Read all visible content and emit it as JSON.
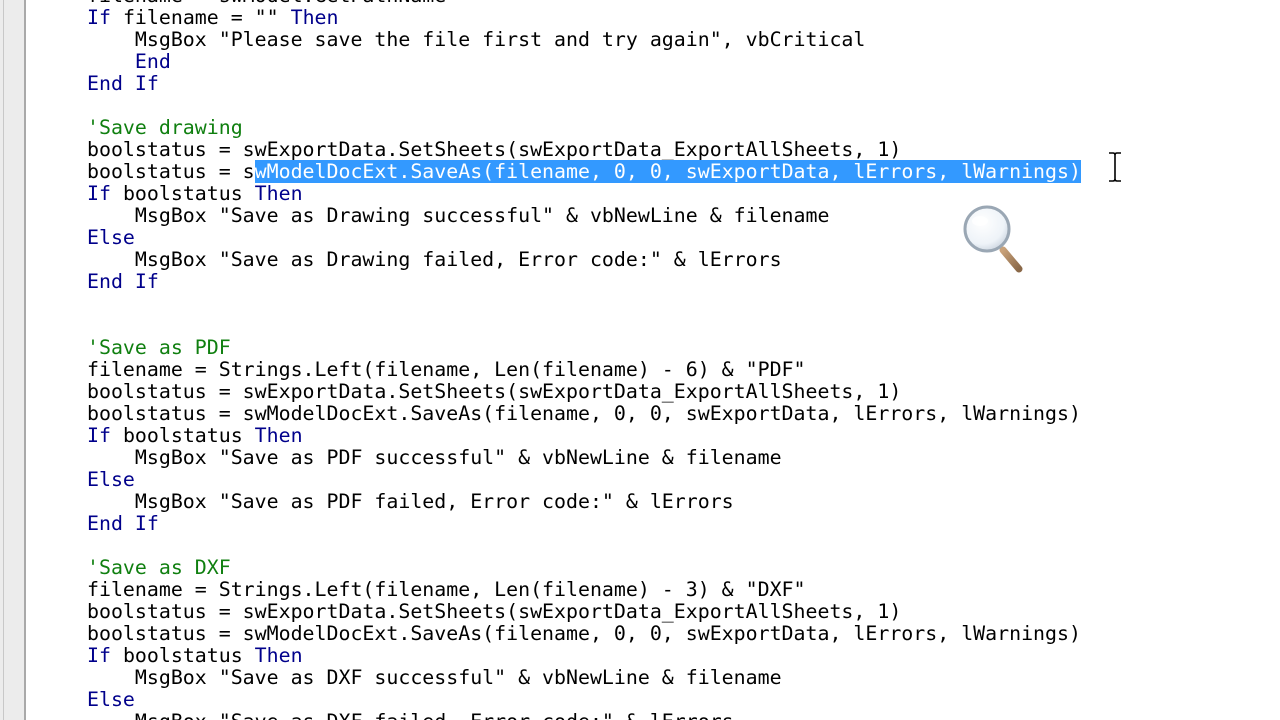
{
  "editor": {
    "lines": [
      [
        {
          "t": "filename = swModel.GetPathName",
          "c": "text"
        }
      ],
      [
        {
          "t": "If ",
          "c": "keyword"
        },
        {
          "t": "filename = \"\" ",
          "c": "text"
        },
        {
          "t": "Then",
          "c": "keyword"
        }
      ],
      [
        {
          "t": "    MsgBox \"Please save the file first and try again\", vbCritical",
          "c": "text"
        }
      ],
      [
        {
          "t": "    End",
          "c": "keyword"
        }
      ],
      [
        {
          "t": "End If",
          "c": "keyword"
        }
      ],
      [
        {
          "t": "",
          "c": "text"
        }
      ],
      [
        {
          "t": "'Save drawing",
          "c": "comment"
        }
      ],
      [
        {
          "t": "boolstatus = swExportData.SetSheets(swExportData_ExportAllSheets, 1)",
          "c": "text"
        }
      ],
      [
        {
          "t": "boolstatus = s",
          "c": "text"
        },
        {
          "t": "wModelDocExt.SaveAs(filename, 0, 0, swExportData, lErrors, lWarnings)",
          "c": "selected"
        }
      ],
      [
        {
          "t": "If ",
          "c": "keyword"
        },
        {
          "t": "boolstatus ",
          "c": "text"
        },
        {
          "t": "Then",
          "c": "keyword"
        }
      ],
      [
        {
          "t": "    MsgBox \"Save as Drawing successful\" & vbNewLine & filename",
          "c": "text"
        }
      ],
      [
        {
          "t": "Else",
          "c": "keyword"
        }
      ],
      [
        {
          "t": "    MsgBox \"Save as Drawing failed, Error code:\" & lErrors",
          "c": "text"
        }
      ],
      [
        {
          "t": "End If",
          "c": "keyword"
        }
      ],
      [
        {
          "t": "",
          "c": "text"
        }
      ],
      [
        {
          "t": "",
          "c": "text"
        }
      ],
      [
        {
          "t": "'Save as PDF",
          "c": "comment"
        }
      ],
      [
        {
          "t": "filename = Strings.Left(filename, Len(filename) - 6) & \"PDF\"",
          "c": "text"
        }
      ],
      [
        {
          "t": "boolstatus = swExportData.SetSheets(swExportData_ExportAllSheets, 1)",
          "c": "text"
        }
      ],
      [
        {
          "t": "boolstatus = swModelDocExt.SaveAs(filename, 0, 0, swExportData, lErrors, lWarnings)",
          "c": "text"
        }
      ],
      [
        {
          "t": "If ",
          "c": "keyword"
        },
        {
          "t": "boolstatus ",
          "c": "text"
        },
        {
          "t": "Then",
          "c": "keyword"
        }
      ],
      [
        {
          "t": "    MsgBox \"Save as PDF successful\" & vbNewLine & filename",
          "c": "text"
        }
      ],
      [
        {
          "t": "Else",
          "c": "keyword"
        }
      ],
      [
        {
          "t": "    MsgBox \"Save as PDF failed, Error code:\" & lErrors",
          "c": "text"
        }
      ],
      [
        {
          "t": "End If",
          "c": "keyword"
        }
      ],
      [
        {
          "t": "",
          "c": "text"
        }
      ],
      [
        {
          "t": "'Save as DXF",
          "c": "comment"
        }
      ],
      [
        {
          "t": "filename = Strings.Left(filename, Len(filename) - 3) & \"DXF\"",
          "c": "text"
        }
      ],
      [
        {
          "t": "boolstatus = swExportData.SetSheets(swExportData_ExportAllSheets, 1)",
          "c": "text"
        }
      ],
      [
        {
          "t": "boolstatus = swModelDocExt.SaveAs(filename, 0, 0, swExportData, lErrors, lWarnings)",
          "c": "text"
        }
      ],
      [
        {
          "t": "If ",
          "c": "keyword"
        },
        {
          "t": "boolstatus ",
          "c": "text"
        },
        {
          "t": "Then",
          "c": "keyword"
        }
      ],
      [
        {
          "t": "    MsgBox \"Save as DXF successful\" & vbNewLine & filename",
          "c": "text"
        }
      ],
      [
        {
          "t": "Else",
          "c": "keyword"
        }
      ],
      [
        {
          "t": "    MsgBox \"Save as DXF failed, Error code:\" & lErrors",
          "c": "text"
        }
      ]
    ]
  },
  "colors": {
    "keyword": "#00008b",
    "comment": "#0f7f0f",
    "selection_bg": "#3399ff",
    "selection_fg": "#ffffff",
    "margin": "#ececec"
  },
  "icons": {
    "cursor": "ibeam-cursor",
    "zoom": "magnifier-icon"
  }
}
